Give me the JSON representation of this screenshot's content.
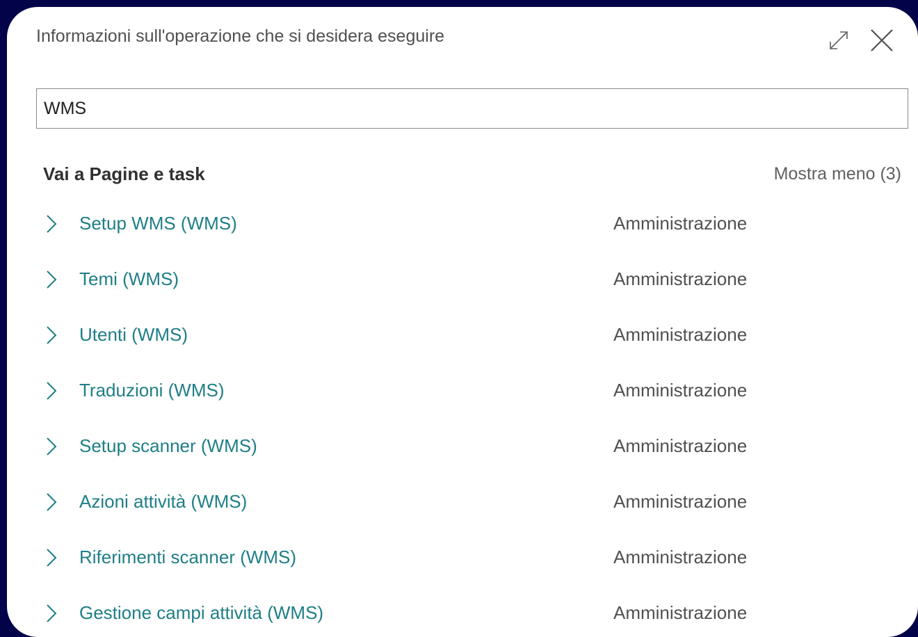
{
  "dialog": {
    "title": "Informazioni sull'operazione che si desidera eseguire",
    "expand_icon": "expand-diagonal-icon",
    "close_icon": "close-icon"
  },
  "search": {
    "value": "WMS"
  },
  "section": {
    "title": "Vai a Pagine e task",
    "toggle_label": "Mostra meno (3)"
  },
  "results": [
    {
      "name": "Setup WMS (WMS)",
      "category": "Amministrazione",
      "icon": "chevron-right-icon"
    },
    {
      "name": "Temi (WMS)",
      "category": "Amministrazione",
      "icon": "chevron-right-icon"
    },
    {
      "name": "Utenti (WMS)",
      "category": "Amministrazione",
      "icon": "chevron-right-icon"
    },
    {
      "name": "Traduzioni (WMS)",
      "category": "Amministrazione",
      "icon": "chevron-right-icon"
    },
    {
      "name": "Setup scanner (WMS)",
      "category": "Amministrazione",
      "icon": "chevron-right-icon"
    },
    {
      "name": "Azioni attività (WMS)",
      "category": "Amministrazione",
      "icon": "chevron-right-icon"
    },
    {
      "name": "Riferimenti scanner (WMS)",
      "category": "Amministrazione",
      "icon": "chevron-right-icon"
    },
    {
      "name": "Gestione campi attività (WMS)",
      "category": "Amministrazione",
      "icon": "chevron-right-icon"
    }
  ],
  "colors": {
    "backdrop": "#03034a",
    "link": "#1e7e86",
    "secondary_text": "#505050"
  }
}
